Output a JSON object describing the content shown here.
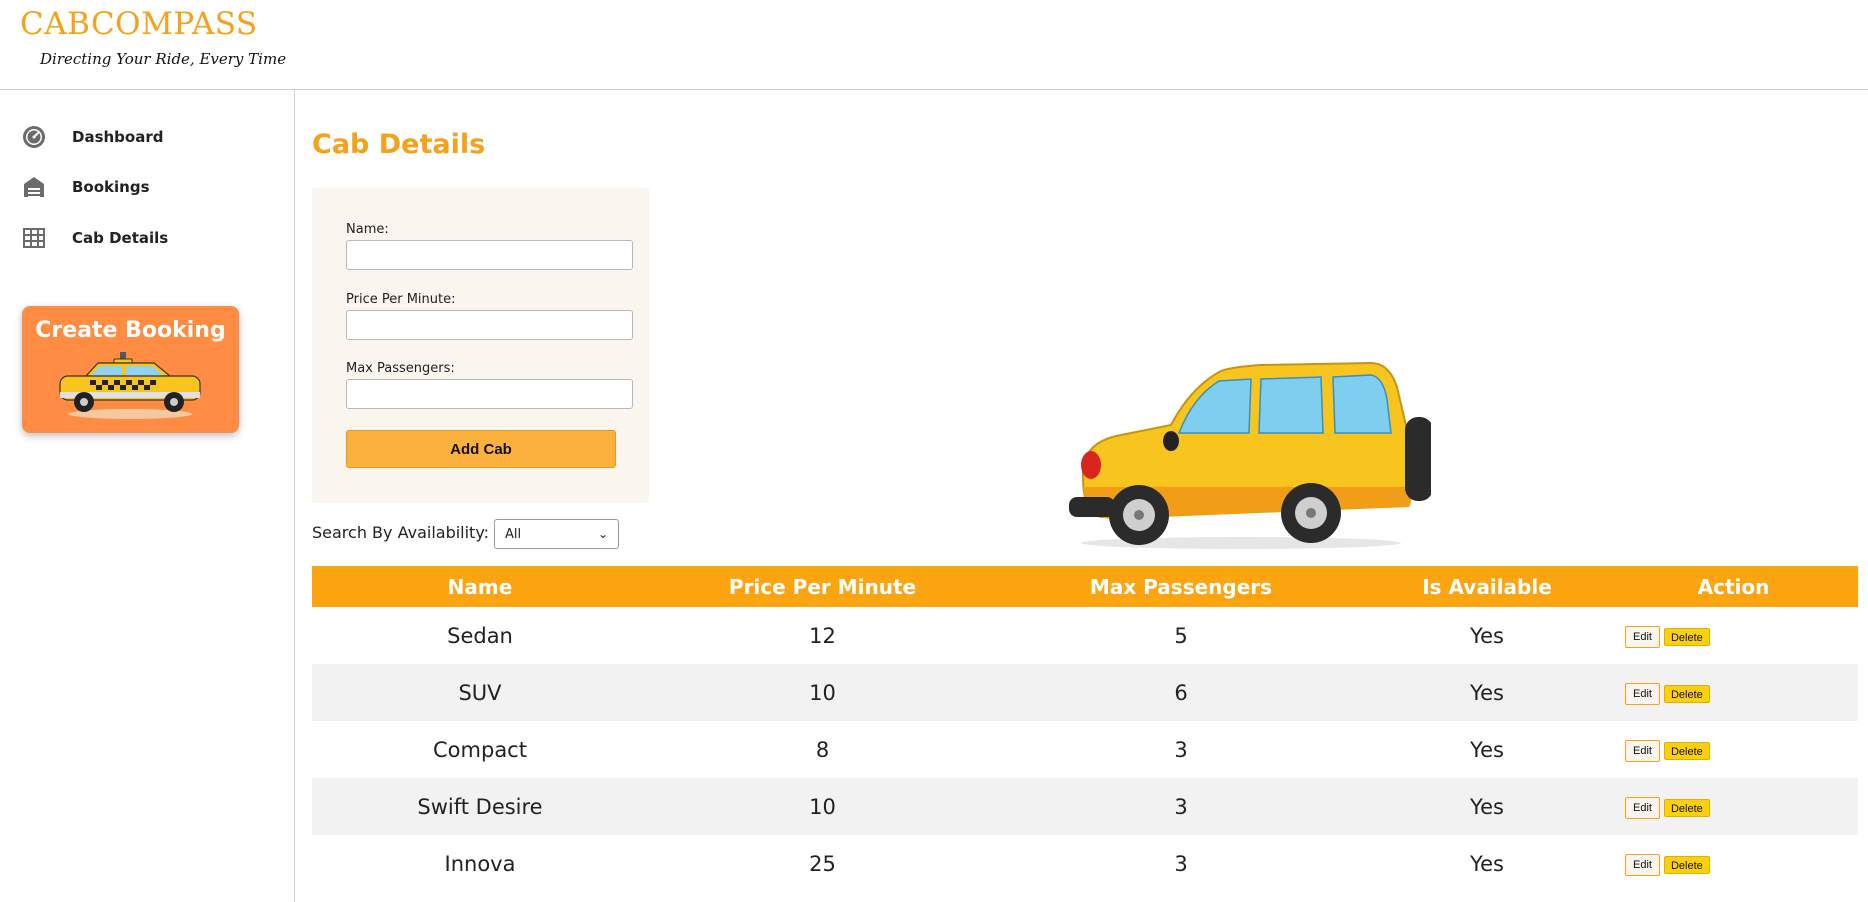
{
  "header": {
    "brand": "CABCOMPASS",
    "tagline": "Directing Your Ride, Every Time"
  },
  "sidebar": {
    "items": [
      {
        "label": "Dashboard",
        "icon": "speedometer-icon"
      },
      {
        "label": "Bookings",
        "icon": "garage-icon"
      },
      {
        "label": "Cab Details",
        "icon": "grid-table-icon"
      }
    ],
    "create_booking": {
      "label": "Create Booking",
      "icon": "taxi-icon"
    }
  },
  "main": {
    "title": "Cab Details",
    "form": {
      "name_label": "Name:",
      "name_value": "",
      "price_label": "Price Per Minute:",
      "price_value": "",
      "max_label": "Max Passengers:",
      "max_value": "",
      "submit_label": "Add Cab"
    },
    "search": {
      "label": "Search By Availability:",
      "selected": "All"
    },
    "illustration": "yellow-car-image",
    "table": {
      "headers": [
        "Name",
        "Price Per Minute",
        "Max Passengers",
        "Is Available",
        "Action"
      ],
      "rows": [
        {
          "name": "Sedan",
          "price": "12",
          "max": "5",
          "available": "Yes"
        },
        {
          "name": "SUV",
          "price": "10",
          "max": "6",
          "available": "Yes"
        },
        {
          "name": "Compact",
          "price": "8",
          "max": "3",
          "available": "Yes"
        },
        {
          "name": "Swift Desire",
          "price": "10",
          "max": "3",
          "available": "Yes"
        },
        {
          "name": "Innova",
          "price": "25",
          "max": "3",
          "available": "Yes"
        }
      ],
      "edit_label": "Edit",
      "delete_label": "Delete"
    }
  },
  "colors": {
    "accent": "#f5a11a",
    "table_header": "#fca510",
    "create_booking_bg": "#ff8c42",
    "add_button": "#fbb13c",
    "delete_button": "#fccf0f"
  }
}
